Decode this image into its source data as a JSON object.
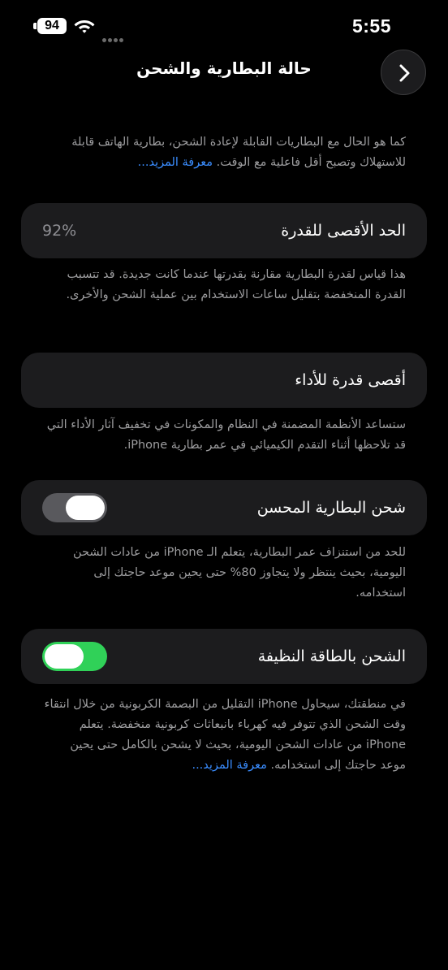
{
  "status_bar": {
    "battery": "94",
    "time": "5:55",
    "wifi_icon": "wifi-icon",
    "signal_icon": "cellular-signal-icon"
  },
  "nav": {
    "title": "حالة البطارية والشحن",
    "back_icon": "chevron-right-icon"
  },
  "intro": {
    "text": "كما هو الحال مع البطاريات القابلة لإعادة الشحن، بطارية الهاتف قابلة للاستهلاك وتصبح أقل فاعلية مع الوقت.",
    "link": "معرفة المزيد..."
  },
  "max_capacity": {
    "label": "الحد الأقصى للقدرة",
    "value": "92%",
    "note": "هذا قياس لقدرة البطارية مقارنة بقدرتها عندما كانت جديدة. قد تتسبب القدرة المنخفضة بتقليل ساعات الاستخدام بين عملية الشحن والأخرى."
  },
  "peak_performance": {
    "label": "أقصى قدرة للأداء",
    "note": "ستساعد الأنظمة المضمنة في النظام والمكونات في تخفيف آثار الأداء التي قد تلاحظها أثناء التقدم الكيميائي في عمر بطارية iPhone."
  },
  "optimized_charging": {
    "label": "شحن البطارية المحسن",
    "enabled": false,
    "note": "للحد من استنزاف عمر البطارية، يتعلم الـ iPhone من عادات الشحن اليومية، بحيث ينتظر ولا يتجاوز 80% حتى يحين موعد حاجتك إلى استخدامه."
  },
  "clean_energy": {
    "label": "الشحن بالطاقة النظيفة",
    "enabled": true,
    "note": "في منطقتك، سيحاول iPhone التقليل من البصمة الكربونية من خلال انتقاء وقت الشحن الذي تتوفر فيه كهرباء بانبعاثات كربونية منخفضة. يتعلم iPhone من عادات الشحن اليومية، بحيث لا يشحن بالكامل حتى يحين موعد حاجتك إلى استخدامه.",
    "link": "معرفة المزيد..."
  },
  "colors": {
    "background": "#000000",
    "card": "#1c1c1e",
    "toggle_on": "#30d158",
    "toggle_off": "#59595d",
    "link": "#3a8dff"
  }
}
